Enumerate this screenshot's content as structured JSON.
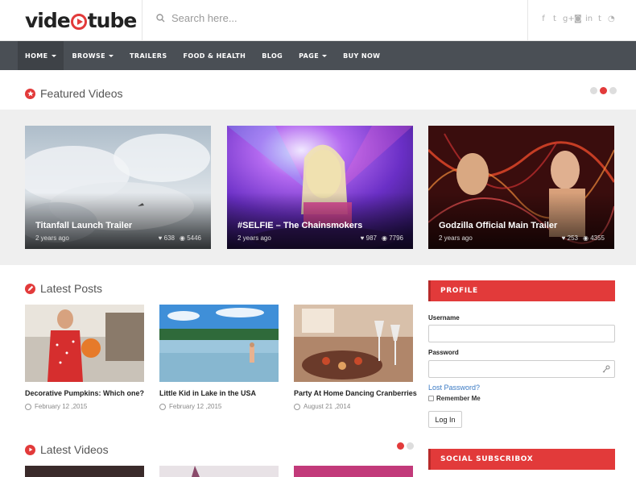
{
  "header": {
    "logo_text_left": "vide",
    "logo_text_right": "tube",
    "search_placeholder": "Search here...",
    "social_icons": [
      "facebook-icon",
      "twitter-icon",
      "google-plus-icon",
      "instagram-icon",
      "linkedin-icon",
      "tumblr-icon",
      "rss-icon"
    ],
    "social_glyphs": [
      "f",
      "t",
      "g+",
      "◙",
      "in",
      "t",
      "◔"
    ]
  },
  "nav": {
    "items": [
      {
        "label": "HOME",
        "dropdown": true,
        "active": true
      },
      {
        "label": "BROWSE",
        "dropdown": true
      },
      {
        "label": "TRAILERS",
        "dropdown": false
      },
      {
        "label": "FOOD & HEALTH",
        "dropdown": false
      },
      {
        "label": "BLOG",
        "dropdown": false
      },
      {
        "label": "PAGE",
        "dropdown": true
      },
      {
        "label": "BUY NOW",
        "dropdown": false
      }
    ]
  },
  "featured": {
    "title": "Featured Videos",
    "active_slide": 2,
    "slide_count": 3,
    "videos": [
      {
        "title": "Titanfall Launch Trailer",
        "date": "2 years ago",
        "likes": "638",
        "views": "5446"
      },
      {
        "title": "#SELFIE – The Chainsmokers",
        "date": "2 years ago",
        "likes": "987",
        "views": "7796"
      },
      {
        "title": "Godzilla Official Main Trailer",
        "date": "2 years ago",
        "likes": "253",
        "views": "4355"
      }
    ]
  },
  "latest_posts": {
    "title": "Latest Posts",
    "posts": [
      {
        "title": "Decorative Pumpkins: Which one?",
        "date": "February 12 ,2015"
      },
      {
        "title": "Little Kid in Lake in the USA",
        "date": "February 12 ,2015"
      },
      {
        "title": "Party At Home Dancing Cranberries",
        "date": "August 21 ,2014"
      }
    ]
  },
  "latest_videos": {
    "title": "Latest Videos",
    "active_slide": 1,
    "slide_count": 2
  },
  "sidebar": {
    "profile_title": "PROFILE",
    "username_label": "Username",
    "password_label": "Password",
    "lost_password": "Lost Password?",
    "remember_me": "Remember Me",
    "login_button": "Log In",
    "social_title": "SOCIAL SUBSCRIBOX"
  },
  "colors": {
    "accent": "#e23a3a",
    "nav_bg": "#4a4f55",
    "link": "#3a7ac4"
  }
}
